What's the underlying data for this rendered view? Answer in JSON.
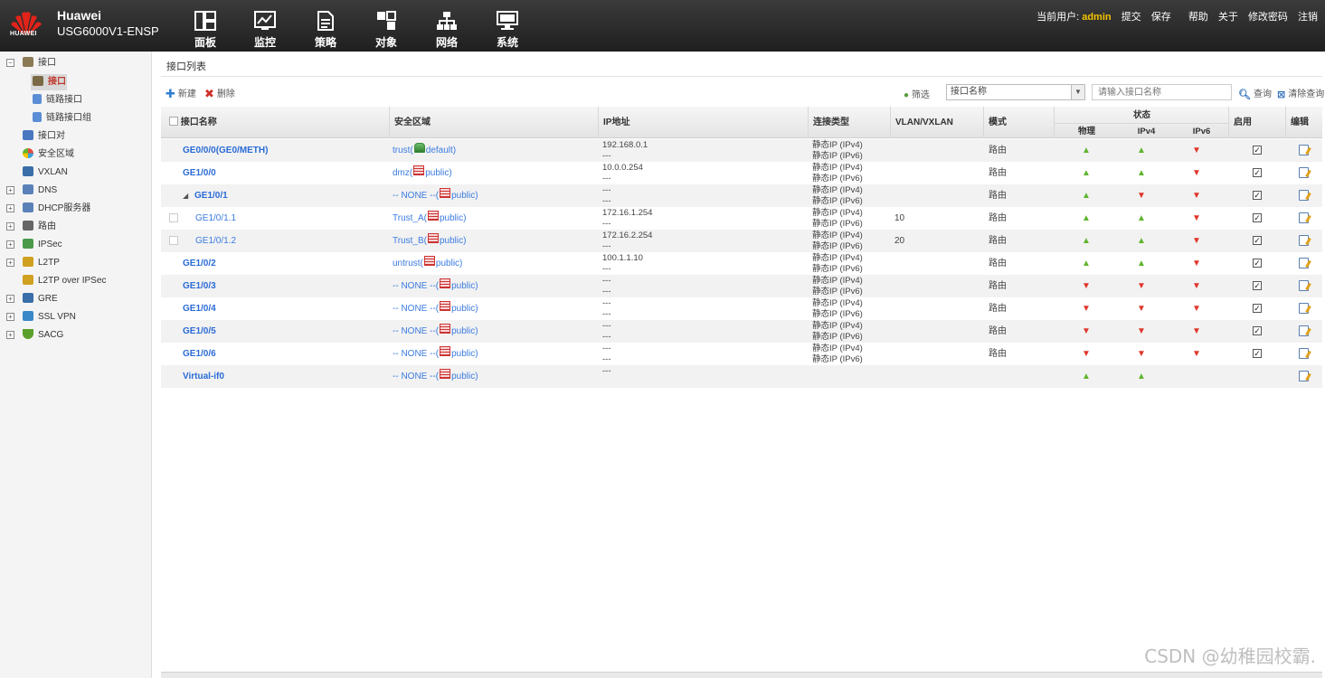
{
  "header": {
    "logo_text": "HUAWEI",
    "brand": "Huawei",
    "model": "USG6000V1-ENSP",
    "nav": [
      {
        "label": "面板",
        "icon": "dashboard-icon"
      },
      {
        "label": "监控",
        "icon": "monitor-icon"
      },
      {
        "label": "策略",
        "icon": "policy-icon"
      },
      {
        "label": "对象",
        "icon": "object-icon"
      },
      {
        "label": "网络",
        "icon": "network-icon"
      },
      {
        "label": "系统",
        "icon": "system-icon"
      }
    ],
    "user_prefix": "当前用户:",
    "username": "admin",
    "links": [
      "提交",
      "保存",
      "帮助",
      "关于",
      "修改密码",
      "注销"
    ]
  },
  "sidebar": {
    "items": [
      {
        "label": "接口",
        "expander": "−",
        "icon_color": "#8a7a55"
      },
      {
        "label": "接口",
        "selected": true,
        "icon_color": "#7a6a45"
      },
      {
        "label": "链路接口",
        "icon_color": "#5b8ed6"
      },
      {
        "label": "链路接口组",
        "icon_color": "#5b8ed6"
      },
      {
        "label": "接口对",
        "icon_color": "#4a78c0"
      },
      {
        "label": "安全区域",
        "icon_color": "#3aa0d8"
      },
      {
        "label": "VXLAN",
        "icon_color": "#3a6ea8"
      },
      {
        "label": "DNS",
        "expander": "+",
        "icon_color": "#5a82b8"
      },
      {
        "label": "DHCP服务器",
        "expander": "+",
        "icon_color": "#5a82b8"
      },
      {
        "label": "路由",
        "expander": "+",
        "icon_color": "#666666"
      },
      {
        "label": "IPSec",
        "expander": "+",
        "icon_color": "#4a9a4a"
      },
      {
        "label": "L2TP",
        "expander": "+",
        "icon_color": "#d0a020"
      },
      {
        "label": "L2TP over IPSec",
        "icon_color": "#d0a020"
      },
      {
        "label": "GRE",
        "expander": "+",
        "icon_color": "#3a6ea8"
      },
      {
        "label": "SSL VPN",
        "expander": "+",
        "icon_color": "#3a88c8"
      },
      {
        "label": "SACG",
        "expander": "+",
        "icon_color": "#5aa02a"
      }
    ]
  },
  "panel": {
    "title": "接口列表",
    "add_label": "新建",
    "delete_label": "删除",
    "filter_label": "筛选",
    "filter_value": "接口名称",
    "search_placeholder": "请输入接口名称",
    "query_label": "查询",
    "clear_label": "清除查询"
  },
  "table": {
    "headers": {
      "name": "接口名称",
      "zone": "安全区域",
      "ip": "IP地址",
      "conn": "连接类型",
      "vlan": "VLAN/VXLAN",
      "mode": "模式",
      "status": "状态",
      "physical": "物理",
      "ipv4": "IPv4",
      "ipv6": "IPv6",
      "enable": "启用",
      "edit": "编辑"
    },
    "rows": [
      {
        "name": "GE0/0/0(GE0/METH)",
        "zone": "trust(",
        "vsys": "default)",
        "zone_icon": "green",
        "ip1": "192.168.0.1",
        "ip2": "---",
        "conn1": "静态IP (IPv4)",
        "conn2": "静态IP (IPv6)",
        "vlan": "",
        "mode": "路由",
        "phy": "up",
        "ipv4": "up",
        "ipv6": "down",
        "enabled": true
      },
      {
        "name": "GE1/0/0",
        "zone": "dmz(",
        "vsys": "public)",
        "ip1": "10.0.0.254",
        "ip2": "---",
        "conn1": "静态IP (IPv4)",
        "conn2": "静态IP (IPv6)",
        "vlan": "",
        "mode": "路由",
        "phy": "up",
        "ipv4": "up",
        "ipv6": "down",
        "enabled": true
      },
      {
        "name": "GE1/0/1",
        "parent": true,
        "zone": "-- NONE --(",
        "vsys": "public)",
        "ip1": "---",
        "ip2": "---",
        "conn1": "静态IP (IPv4)",
        "conn2": "静态IP (IPv6)",
        "vlan": "",
        "mode": "路由",
        "phy": "up",
        "ipv4": "down",
        "ipv6": "down",
        "enabled": true
      },
      {
        "name": "GE1/0/1.1",
        "child": true,
        "zone": "Trust_A(",
        "vsys": "public)",
        "ip1": "172.16.1.254",
        "ip2": "---",
        "conn1": "静态IP (IPv4)",
        "conn2": "静态IP (IPv6)",
        "vlan": "10",
        "mode": "路由",
        "phy": "up",
        "ipv4": "up",
        "ipv6": "down",
        "enabled": true
      },
      {
        "name": "GE1/0/1.2",
        "child": true,
        "zone": "Trust_B(",
        "vsys": "public)",
        "ip1": "172.16.2.254",
        "ip2": "---",
        "conn1": "静态IP (IPv4)",
        "conn2": "静态IP (IPv6)",
        "vlan": "20",
        "mode": "路由",
        "phy": "up",
        "ipv4": "up",
        "ipv6": "down",
        "enabled": true
      },
      {
        "name": "GE1/0/2",
        "zone": "untrust(",
        "vsys": "public)",
        "ip1": "100.1.1.10",
        "ip2": "---",
        "conn1": "静态IP (IPv4)",
        "conn2": "静态IP (IPv6)",
        "vlan": "",
        "mode": "路由",
        "phy": "up",
        "ipv4": "up",
        "ipv6": "down",
        "enabled": true
      },
      {
        "name": "GE1/0/3",
        "zone": "-- NONE --(",
        "vsys": "public)",
        "ip1": "---",
        "ip2": "---",
        "conn1": "静态IP (IPv4)",
        "conn2": "静态IP (IPv6)",
        "vlan": "",
        "mode": "路由",
        "phy": "down",
        "ipv4": "down",
        "ipv6": "down",
        "enabled": true
      },
      {
        "name": "GE1/0/4",
        "zone": "-- NONE --(",
        "vsys": "public)",
        "ip1": "---",
        "ip2": "---",
        "conn1": "静态IP (IPv4)",
        "conn2": "静态IP (IPv6)",
        "vlan": "",
        "mode": "路由",
        "phy": "down",
        "ipv4": "down",
        "ipv6": "down",
        "enabled": true
      },
      {
        "name": "GE1/0/5",
        "zone": "-- NONE --(",
        "vsys": "public)",
        "ip1": "---",
        "ip2": "---",
        "conn1": "静态IP (IPv4)",
        "conn2": "静态IP (IPv6)",
        "vlan": "",
        "mode": "路由",
        "phy": "down",
        "ipv4": "down",
        "ipv6": "down",
        "enabled": true
      },
      {
        "name": "GE1/0/6",
        "zone": "-- NONE --(",
        "vsys": "public)",
        "ip1": "---",
        "ip2": "---",
        "conn1": "静态IP (IPv4)",
        "conn2": "静态IP (IPv6)",
        "vlan": "",
        "mode": "路由",
        "phy": "down",
        "ipv4": "down",
        "ipv6": "down",
        "enabled": true
      },
      {
        "name": "Virtual-if0",
        "zone": "-- NONE --(",
        "vsys": "public)",
        "ip1": "---",
        "ip2": "",
        "conn1": "",
        "conn2": "",
        "vlan": "",
        "mode": "",
        "phy": "up",
        "ipv4": "up",
        "ipv6": "",
        "enabled": false
      }
    ]
  },
  "watermark": "CSDN @幼稚园校霸.",
  "colors": {
    "header_bg": "#2b2b2b",
    "accent_user": "#f5c400",
    "link_blue": "#2a6bd6",
    "status_up": "#5fb52e",
    "status_down": "#e0352b"
  }
}
